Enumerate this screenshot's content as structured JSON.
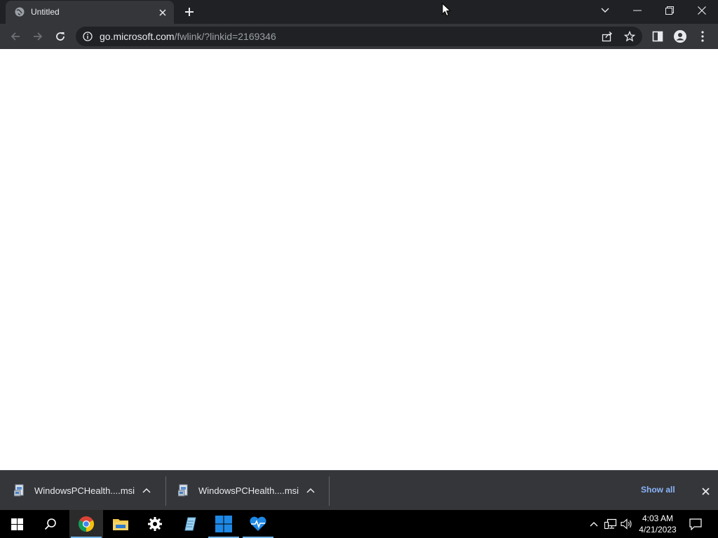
{
  "browser": {
    "tab": {
      "title": "Untitled"
    },
    "address": {
      "host": "go.microsoft.com",
      "path": "/fwlink/?linkid=2169346"
    }
  },
  "downloads": {
    "items": [
      {
        "filename": "WindowsPCHealth....msi"
      },
      {
        "filename": "WindowsPCHealth....msi"
      }
    ],
    "show_all_label": "Show all"
  },
  "taskbar": {
    "pinned": [
      "start-icon",
      "search-icon",
      "chrome-icon",
      "file-explorer-icon",
      "settings-icon",
      "notepad-icon",
      "windows-logo-icon",
      "pc-health-check-icon"
    ],
    "clock": {
      "time": "4:03 AM",
      "date": "4/21/2023"
    }
  },
  "colors": {
    "titlebar": "#202124",
    "toolbar": "#35363a",
    "link": "#8ab4f8",
    "taskbar": "#000000",
    "accent": "#76b9ed"
  }
}
